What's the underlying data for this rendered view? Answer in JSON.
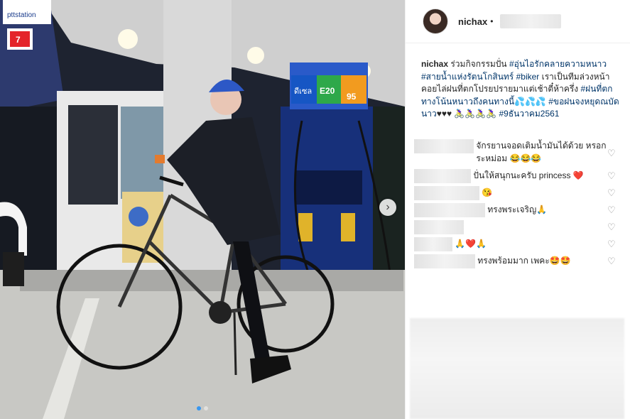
{
  "post": {
    "username": "nichax",
    "bullet": "•",
    "caption": {
      "username": "nichax",
      "segments": [
        {
          "text": " ร่วมกิจกรรมปั่น ",
          "tag": false
        },
        {
          "text": "#อุ่นไอรักคลายความหนาว",
          "tag": true
        },
        {
          "text": " ",
          "tag": false
        },
        {
          "text": "#สายน้ำแห่งรัตนโกสินทร์",
          "tag": true
        },
        {
          "text": " ",
          "tag": false
        },
        {
          "text": "#biker",
          "tag": true
        },
        {
          "text": " เราเป็นทีมล่วงหน้าคอยไล่ฝนที่ตกโปรยปรายมาแต่เช้าตี๋ห้าครึ่ง ",
          "tag": false
        },
        {
          "text": "#ฝนที่ตกทางโน้นหนาวถึงคนทางนี้",
          "tag": true
        },
        {
          "text": "💦💦💦 ",
          "tag": false
        },
        {
          "text": "#ขอฝนจงหยุดณบัดนาว",
          "tag": true
        },
        {
          "text": "♥♥♥ 🚴‍♀️🚴‍♀️🚴‍♀️🚴‍♀️ ",
          "tag": false
        },
        {
          "text": "#9ธันวาคม2561",
          "tag": true
        }
      ]
    },
    "comments": [
      {
        "text": "จักรยานจอดเติมน้ำมันได้ด้วย หรอกระหม่อม 😂😂😂"
      },
      {
        "text": "ปั่นให้สนุกนะครับ princess ❤️"
      },
      {
        "text": "😘"
      },
      {
        "text": "ทรงพระเจริญ🙏"
      },
      {
        "text": ""
      },
      {
        "text": "🙏❤️🙏"
      },
      {
        "text": "ทรงพร้อมมาก เพคะ🤩🤩"
      }
    ],
    "heart_icon": "heart-icon",
    "carousel": {
      "next_icon": "chevron-right-icon",
      "slide_count": 2,
      "active_index": 0
    }
  },
  "photo": {
    "pump_brand": "ดีเซล",
    "pump_grade_1": "E20",
    "pump_grade_2": "95",
    "station_sign": "7-ELEVEN",
    "ptt_sign": "pttstation"
  }
}
